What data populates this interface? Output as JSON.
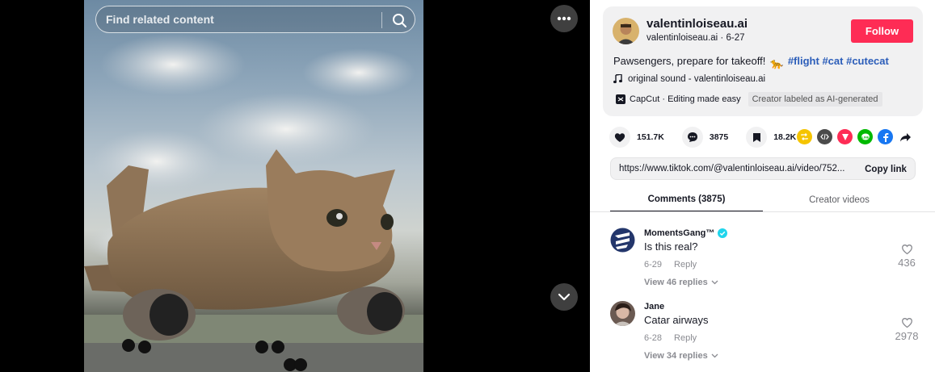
{
  "search": {
    "placeholder": "Find related content"
  },
  "video": {
    "more_label": "More options",
    "scroll_down_label": "Next video"
  },
  "author": {
    "name": "valentinloiseau.ai",
    "handle": "valentinloiseau.ai",
    "separator": " · ",
    "date": "6-27"
  },
  "follow_label": "Follow",
  "caption": {
    "text": "Pawsengers, prepare for takeoff!",
    "emoji": "🐆",
    "hashtags": [
      "#flight",
      "#cat",
      "#cutecat"
    ]
  },
  "sound": {
    "title": "original sound - valentinloiseau.ai"
  },
  "capcut": {
    "label": "CapCut · Editing made easy",
    "ai_label": "Creator labeled as AI-generated"
  },
  "stats": {
    "likes": "151.7K",
    "comments": "3875",
    "saves": "18.2K"
  },
  "share_icons": [
    "repost-icon",
    "embed-icon",
    "send-icon",
    "line-icon",
    "facebook-icon",
    "share-arrow-icon"
  ],
  "share_colors": {
    "repost": "#f5c400",
    "embed": "#4b4b4b",
    "send": "#fe2c55",
    "line": "#00b900",
    "facebook": "#1877f2"
  },
  "link": {
    "url": "https://www.tiktok.com/@valentinloiseau.ai/video/752...",
    "copy_label": "Copy link"
  },
  "tabs": [
    {
      "label": "Comments (3875)",
      "active": true
    },
    {
      "label": "Creator videos",
      "active": false
    }
  ],
  "comments": [
    {
      "user": "MomentsGang™",
      "verified": true,
      "text": "Is this real?",
      "date": "6-29",
      "reply_label": "Reply",
      "replies_label": "View 46 replies",
      "likes": "436"
    },
    {
      "user": "Jane",
      "verified": false,
      "text": "Catar airways",
      "date": "6-28",
      "reply_label": "Reply",
      "replies_label": "View 34 replies",
      "likes": "2978"
    }
  ],
  "colors": {
    "accent": "#fe2c55",
    "hashtag": "#2b5db9",
    "verified": "#20d5ec"
  }
}
